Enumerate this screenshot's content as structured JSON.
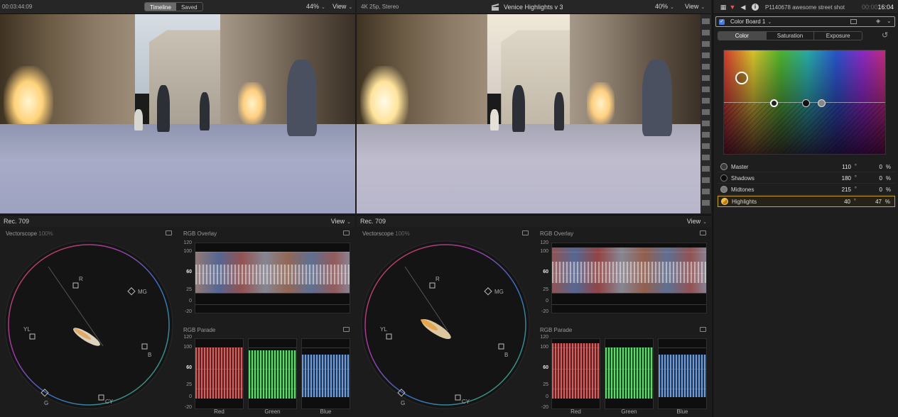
{
  "viewer_left": {
    "timecode": "00:03:44:09",
    "seg_timeline": "Timeline",
    "seg_saved": "Saved",
    "zoom": "44%",
    "view_label": "View"
  },
  "viewer_right": {
    "format": "4K 25p, Stereo",
    "project_title": "Venice Highlights v 3",
    "zoom": "40%",
    "view_label": "View"
  },
  "scopes_left": {
    "colorspace": "Rec. 709",
    "view_label": "View",
    "vectorscope_title": "Vectorscope",
    "vectorscope_pct": "100%",
    "overlay_title": "RGB Overlay",
    "parade_title": "RGB Parade"
  },
  "scopes_right": {
    "colorspace": "Rec. 709",
    "view_label": "View",
    "vectorscope_title": "Vectorscope",
    "vectorscope_pct": "100%",
    "overlay_title": "RGB Overlay",
    "parade_title": "RGB Parade"
  },
  "vector_targets": [
    "R",
    "MG",
    "YL",
    "B",
    "G",
    "CY"
  ],
  "waveform_ticks": [
    "120",
    "100",
    "60",
    "25",
    "0",
    "-20"
  ],
  "parade_channels": [
    "Red",
    "Green",
    "Blue"
  ],
  "inspector": {
    "clip_name": "P1140678 awesome street shot",
    "duration": "00:00",
    "duration_bold": "16:04",
    "effect_name": "Color Board 1",
    "tabs": [
      "Color",
      "Saturation",
      "Exposure"
    ],
    "active_tab": "Color",
    "rows": [
      {
        "label": "Master",
        "angle": "110",
        "value": "0",
        "unit": "%"
      },
      {
        "label": "Shadows",
        "angle": "180",
        "value": "0",
        "unit": "%"
      },
      {
        "label": "Midtones",
        "angle": "215",
        "value": "0",
        "unit": "%"
      },
      {
        "label": "Highlights",
        "angle": "40",
        "value": "47",
        "unit": "%"
      }
    ],
    "degree_symbol": "°",
    "reset_icon": "↺"
  },
  "colors": {
    "selection": "#c9a227",
    "red_channel": "#ff6a6a",
    "green_channel": "#6aff7a",
    "blue_channel": "#7ab4ff"
  }
}
